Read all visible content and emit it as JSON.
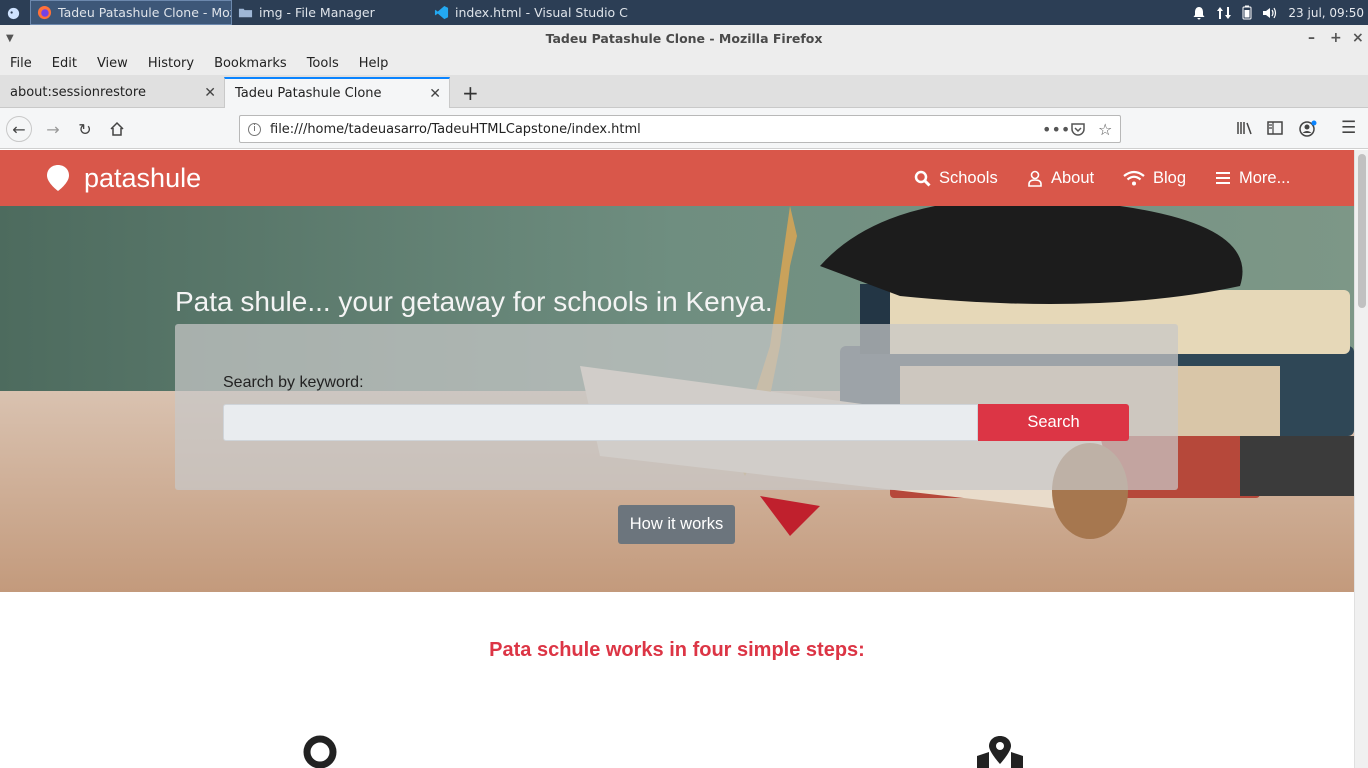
{
  "taskbar": {
    "apps": [
      {
        "label": "Tadeu Patashule Clone - Moz...",
        "icon": "firefox-icon",
        "active": true
      },
      {
        "label": "img - File Manager",
        "icon": "folder-icon",
        "active": false
      },
      {
        "label": "index.html - Visual Studio Co...",
        "icon": "vscode-icon",
        "active": false
      }
    ],
    "clock": "23 jul, 09:50"
  },
  "window": {
    "title": "Tadeu Patashule Clone - Mozilla Firefox"
  },
  "menubar": {
    "items": [
      "File",
      "Edit",
      "View",
      "History",
      "Bookmarks",
      "Tools",
      "Help"
    ]
  },
  "tabs": [
    {
      "label": "about:sessionrestore",
      "active": false
    },
    {
      "label": "Tadeu Patashule Clone",
      "active": true
    }
  ],
  "navbar": {
    "url": "file:///home/tadeuasarro/TadeuHTMLCapstone/index.html"
  },
  "site": {
    "brand": "patashule",
    "nav": [
      "Schools",
      "About",
      "Blog",
      "More..."
    ],
    "hero_title": "Pata shule... your getaway for schools in Kenya.",
    "search_label": "Search by keyword:",
    "search_value": "",
    "search_button": "Search",
    "how_button": "How it works",
    "steps_title": "Pata schule works in four simple steps:"
  },
  "colors": {
    "header": "#d9574a",
    "accent": "#dc3545",
    "secondary_button": "#6c757d"
  }
}
